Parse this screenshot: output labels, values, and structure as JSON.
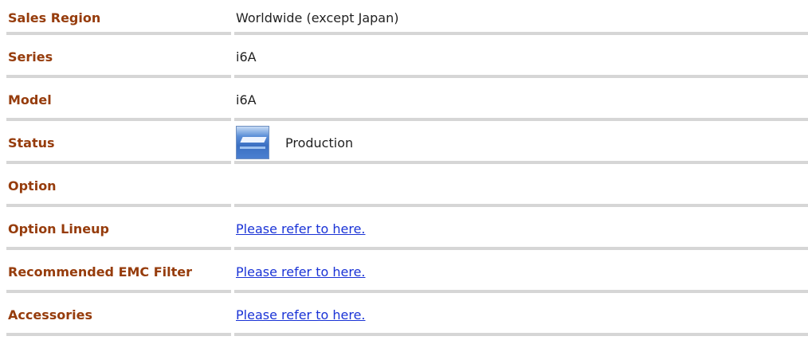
{
  "rows": [
    {
      "label": "Sales Region",
      "value": "Worldwide (except Japan)"
    },
    {
      "label": "Series",
      "value": "i6A"
    },
    {
      "label": "Model",
      "value": "i6A"
    },
    {
      "label": "Status",
      "value": "Production",
      "icon": "production-status-icon"
    },
    {
      "label": "Option",
      "value": ""
    },
    {
      "label": "Option Lineup",
      "link": "Please refer to here."
    },
    {
      "label": "Recommended EMC Filter",
      "link": "Please refer to here."
    },
    {
      "label": "Accessories",
      "link": "Please refer to here."
    }
  ],
  "colors": {
    "label": "#963c0c",
    "link": "#1a33d6",
    "rule": "#d6d6d6"
  }
}
